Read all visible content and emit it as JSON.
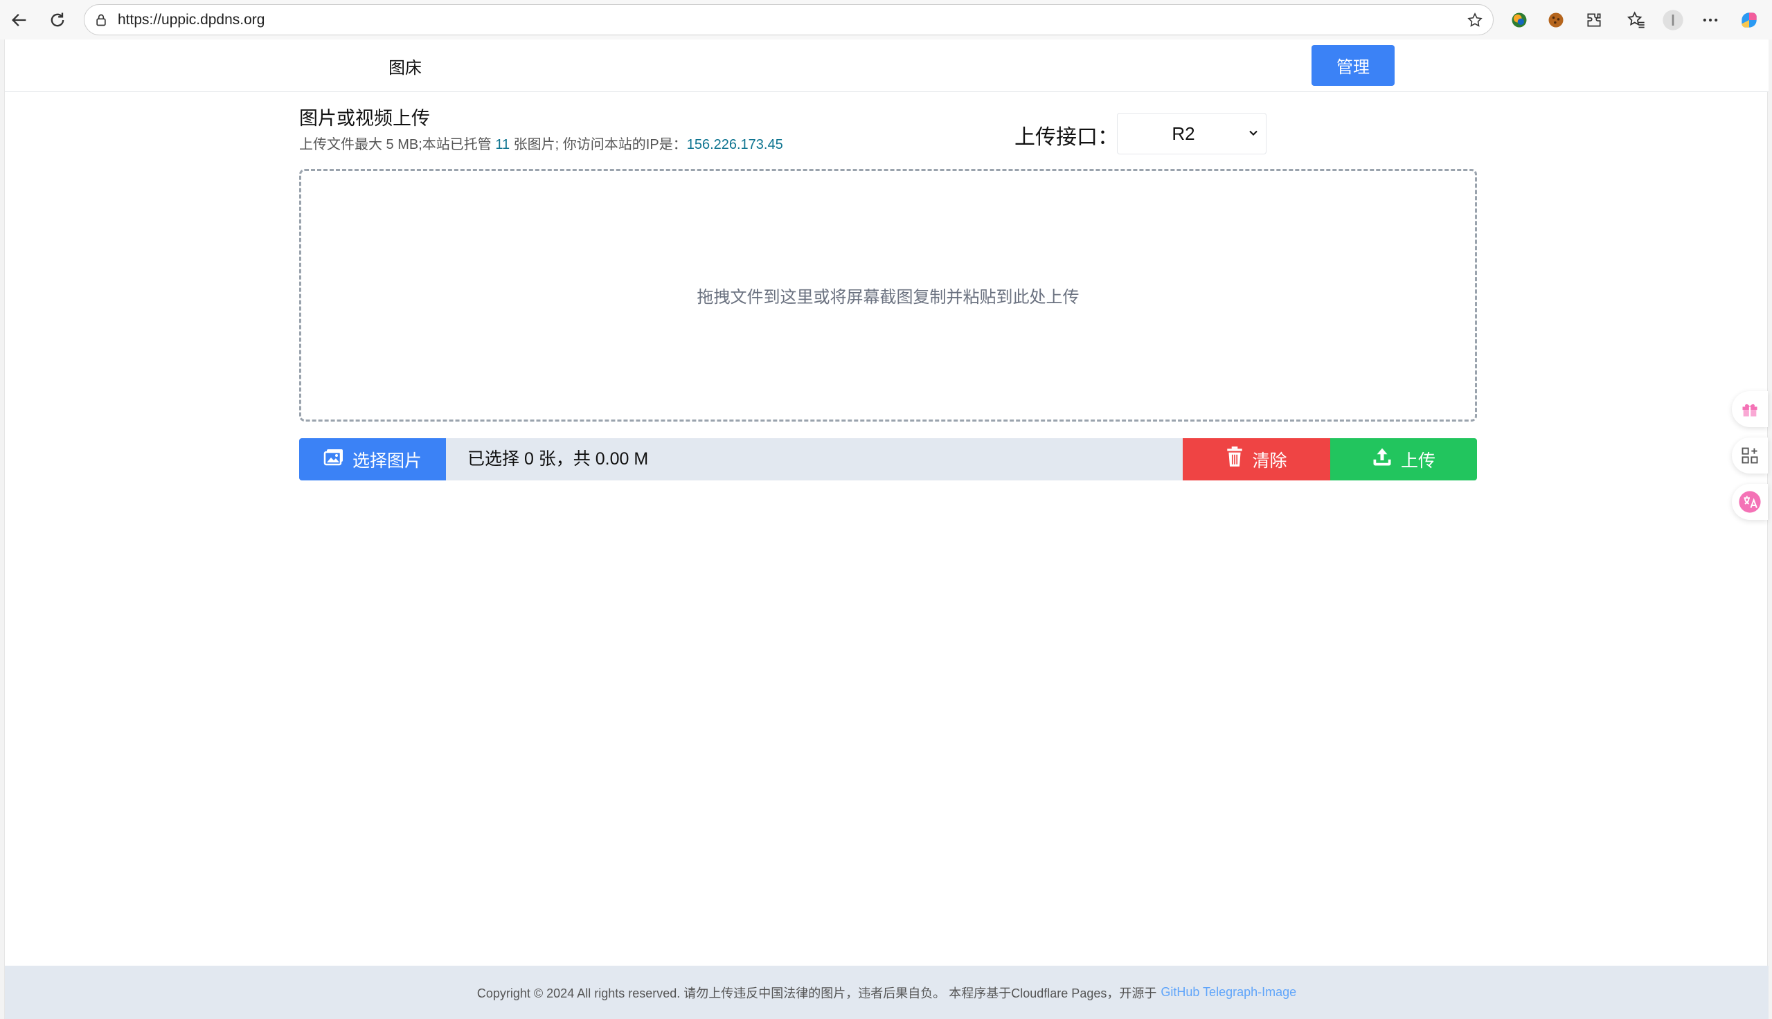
{
  "browser": {
    "url": "https://uppic.dpdns.org"
  },
  "header": {
    "site_title": "图床",
    "manage_label": "管理"
  },
  "upload": {
    "heading": "图片或视频上传",
    "info_prefix": "上传文件最大 5 MB;本站已托管 ",
    "hosted_count": "11",
    "info_middle": " 张图片; 你访问本站的IP是：",
    "ip": "156.226.173.45",
    "api_label": "上传接口：",
    "api_selected": "R2",
    "drop_text": "拖拽文件到这里或将屏幕截图复制并粘贴到此处上传"
  },
  "actions": {
    "choose_label": "选择图片",
    "selected_info": "已选择 0 张，共 0.00 M",
    "clear_label": "清除",
    "upload_label": "上传"
  },
  "footer": {
    "text": "Copyright © 2024 All rights reserved. 请勿上传违反中国法律的图片，违者后果自负。 本程序基于Cloudflare Pages，开源于",
    "link": "GitHub Telegraph-Image"
  },
  "colors": {
    "primary": "#3b82f6",
    "danger": "#ef4444",
    "success": "#22c55e",
    "accent_text": "#0e7490",
    "footer_bg": "#e2e8f0"
  },
  "icons": [
    "back-icon",
    "reload-icon",
    "lock-icon",
    "star-icon",
    "extension-icon",
    "cookie-icon",
    "puzzle-icon",
    "favorites-icon",
    "profile-icon",
    "more-icon",
    "copilot-icon",
    "image-icon",
    "trash-icon",
    "upload-icon",
    "gift-icon",
    "apps-icon",
    "translate-icon"
  ]
}
